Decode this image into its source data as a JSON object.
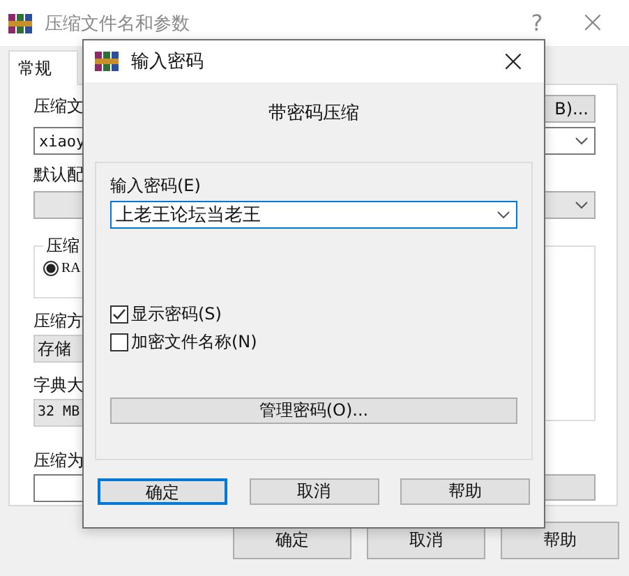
{
  "window": {
    "title": "压缩文件名和参数",
    "help": "?",
    "close": "×"
  },
  "tabs": [
    {
      "label": "常规",
      "selected": true
    }
  ],
  "general": {
    "archive_name_label": "压缩文",
    "browse_button": "B)...",
    "archive_name": "xiaoy",
    "profile_label": "默认配",
    "format_group": "压缩",
    "format_options": [
      {
        "label": "RA",
        "selected": true
      }
    ],
    "method_label": "压缩方",
    "method": "存储",
    "dictionary_label": "字典大",
    "dictionary": "32 MB",
    "split_label": "压缩为"
  },
  "buttons": [
    {
      "label": "确定"
    },
    {
      "label": "取消"
    },
    {
      "label": "帮助"
    }
  ],
  "dialog": {
    "title": "输入密码",
    "close": "×",
    "heading": "带密码压缩",
    "password_label": "输入密码(E)",
    "password": "上老王论坛当老王",
    "options": [
      {
        "label": "显示密码(S)",
        "checked": true
      },
      {
        "label": "加密文件名称(N)",
        "checked": false
      }
    ],
    "manage_button": "管理密码(O)...",
    "buttons": [
      {
        "label": "确定",
        "default": true
      },
      {
        "label": "取消",
        "default": false
      },
      {
        "label": "帮助",
        "default": false
      }
    ]
  }
}
